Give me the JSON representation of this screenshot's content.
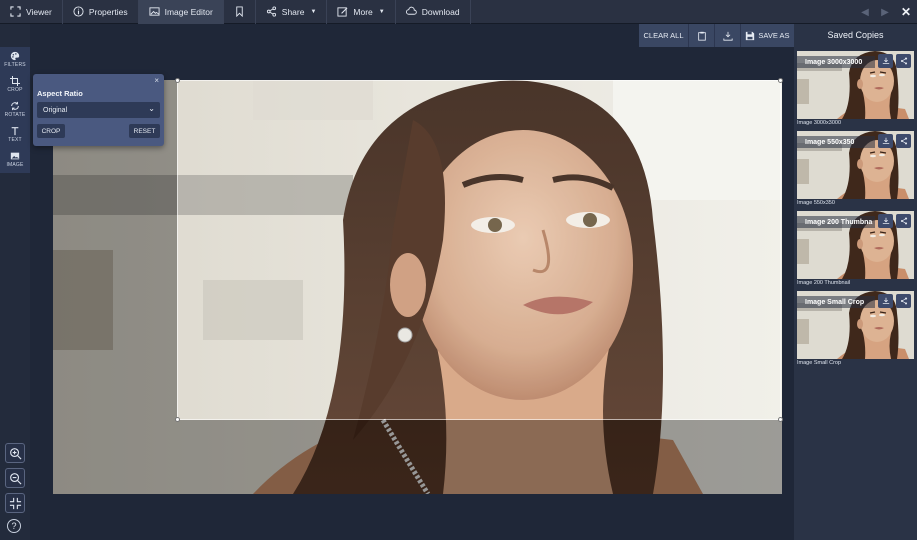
{
  "tabs": [
    {
      "label": "Viewer",
      "icon": "expand-icon",
      "active": false,
      "caret": false
    },
    {
      "label": "Properties",
      "icon": "info-icon",
      "active": false,
      "caret": false
    },
    {
      "label": "Image Editor",
      "icon": "image-icon",
      "active": true,
      "caret": false
    },
    {
      "label": "",
      "icon": "bookmark-icon",
      "active": false,
      "caret": false
    },
    {
      "label": "Share",
      "icon": "share-icon",
      "active": false,
      "caret": true
    },
    {
      "label": "More",
      "icon": "edit-icon",
      "active": false,
      "caret": true
    },
    {
      "label": "Download",
      "icon": "cloud-download-icon",
      "active": false,
      "caret": false
    }
  ],
  "tools": [
    {
      "label": "FILTERS",
      "icon": "palette-icon"
    },
    {
      "label": "CROP",
      "icon": "crop-icon"
    },
    {
      "label": "ROTATE",
      "icon": "rotate-icon"
    },
    {
      "label": "TEXT",
      "icon": "text-icon"
    },
    {
      "label": "IMAGE",
      "icon": "image-icon"
    }
  ],
  "edit_toolbar": {
    "clear_all": "CLEAR ALL",
    "save_as": "SAVE AS"
  },
  "aspect_panel": {
    "title": "Aspect Ratio",
    "selected": "Original",
    "crop": "CROP",
    "reset": "RESET",
    "close": "×"
  },
  "saved_copies": {
    "title": "Saved Copies",
    "items": [
      {
        "caption": "Image 3000x3000",
        "label": "Image 3000x3000"
      },
      {
        "caption": "Image 550x350",
        "label": "Image 550x350"
      },
      {
        "caption": "Image 200 Thumbna",
        "label": "Image 200 Thumbnail"
      },
      {
        "caption": "Image Small Crop",
        "label": "Image Small Crop"
      }
    ]
  },
  "help": "?"
}
